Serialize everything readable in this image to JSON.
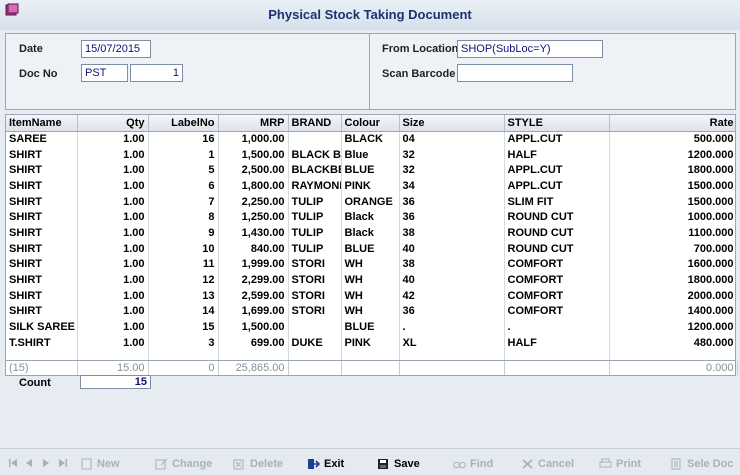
{
  "window": {
    "title": "Physical Stock Taking Document"
  },
  "header": {
    "date_label": "Date",
    "date_value": "15/07/2015",
    "docno_label": "Doc No",
    "docno_prefix": "PST",
    "docno_number": "1",
    "from_location_label": "From Location",
    "from_location_value": "SHOP(SubLoc=Y)",
    "scan_barcode_label": "Scan Barcode",
    "scan_barcode_value": ""
  },
  "grid": {
    "columns": [
      "ItemName",
      "Qty",
      "LabelNo",
      "MRP",
      "BRAND",
      "Colour",
      "Size",
      "STYLE",
      "Rate"
    ],
    "rows": [
      [
        "SAREE",
        "1.00",
        "16",
        "1,000.00",
        "",
        "BLACK",
        "04",
        "APPL.CUT",
        "500.000"
      ],
      [
        "SHIRT",
        "1.00",
        "1",
        "1,500.00",
        "BLACK BER",
        "Blue",
        "32",
        "HALF",
        "1200.000"
      ],
      [
        "SHIRT",
        "1.00",
        "5",
        "2,500.00",
        "BLACKBERI",
        "BLUE",
        "32",
        "APPL.CUT",
        "1800.000"
      ],
      [
        "SHIRT",
        "1.00",
        "6",
        "1,800.00",
        "RAYMOND",
        "PINK",
        "34",
        "APPL.CUT",
        "1500.000"
      ],
      [
        "SHIRT",
        "1.00",
        "7",
        "2,250.00",
        "TULIP",
        "ORANGE",
        "36",
        "SLIM FIT",
        "1500.000"
      ],
      [
        "SHIRT",
        "1.00",
        "8",
        "1,250.00",
        "TULIP",
        "Black",
        "36",
        "ROUND CUT",
        "1000.000"
      ],
      [
        "SHIRT",
        "1.00",
        "9",
        "1,430.00",
        "TULIP",
        "Black",
        "38",
        "ROUND CUT",
        "1100.000"
      ],
      [
        "SHIRT",
        "1.00",
        "10",
        "840.00",
        "TULIP",
        "BLUE",
        "40",
        "ROUND CUT",
        "700.000"
      ],
      [
        "SHIRT",
        "1.00",
        "11",
        "1,999.00",
        "STORI",
        "WH",
        "38",
        "COMFORT",
        "1600.000"
      ],
      [
        "SHIRT",
        "1.00",
        "12",
        "2,299.00",
        "STORI",
        "WH",
        "40",
        "COMFORT",
        "1800.000"
      ],
      [
        "SHIRT",
        "1.00",
        "13",
        "2,599.00",
        "STORI",
        "WH",
        "42",
        "COMFORT",
        "2000.000"
      ],
      [
        "SHIRT",
        "1.00",
        "14",
        "1,699.00",
        "STORI",
        "WH",
        "36",
        "COMFORT",
        "1400.000"
      ],
      [
        "SILK SAREE",
        "1.00",
        "15",
        "1,500.00",
        "",
        "BLUE",
        ".",
        ".",
        "1200.000"
      ],
      [
        "T.SHIRT",
        "1.00",
        "3",
        "699.00",
        "DUKE",
        "PINK",
        "XL",
        "HALF",
        "480.000"
      ]
    ],
    "totals": [
      "(15)",
      "15.00",
      "0",
      "25,865.00",
      "",
      "",
      "",
      "",
      "0.000"
    ]
  },
  "count": {
    "label": "Count",
    "value": "15"
  },
  "toolbar": {
    "new_label": "New",
    "change_label": "Change",
    "delete_label": "Delete",
    "exit_label": "Exit",
    "save_label": "Save",
    "find_label": "Find",
    "cancel_label": "Cancel",
    "print_label": "Print",
    "sele_doc_label": "Sele Doc"
  },
  "colors": {
    "title": "#1a3470",
    "field_text": "#10107a",
    "disabled": "#a9b0ba"
  }
}
